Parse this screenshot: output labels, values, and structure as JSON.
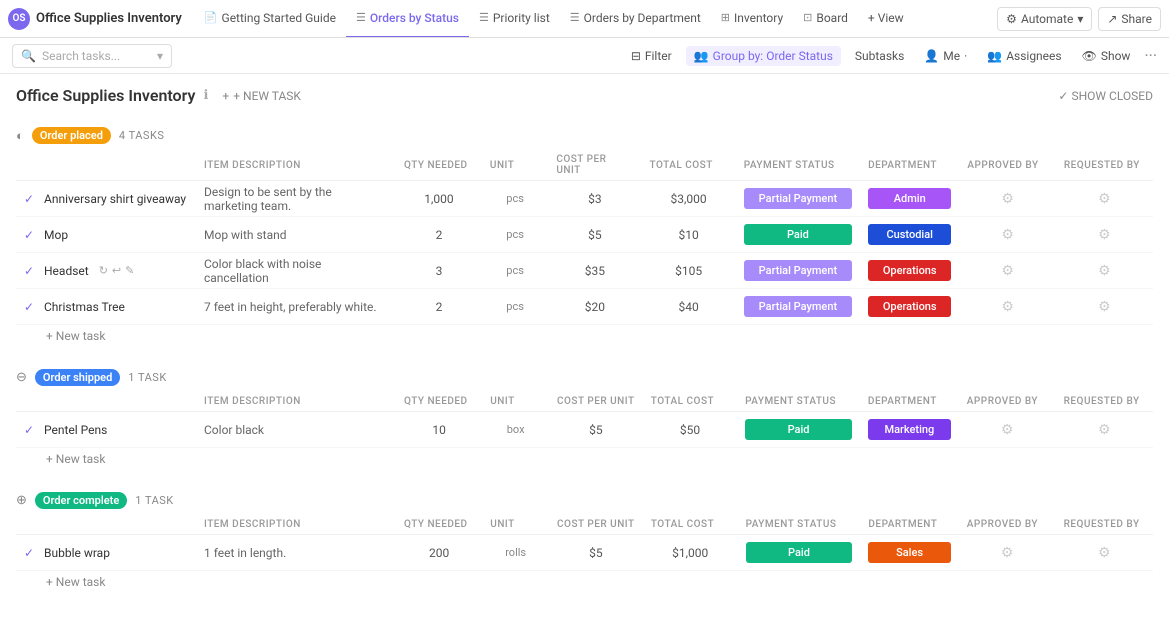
{
  "app": {
    "logo_text": "OS",
    "title": "Office Supplies Inventory"
  },
  "nav": {
    "tabs": [
      {
        "id": "getting-started",
        "label": "Getting Started Guide",
        "icon": "📄",
        "active": false
      },
      {
        "id": "orders-by-status",
        "label": "Orders by Status",
        "icon": "☰",
        "active": true
      },
      {
        "id": "priority-list",
        "label": "Priority list",
        "icon": "☰",
        "active": false
      },
      {
        "id": "orders-by-dept",
        "label": "Orders by Department",
        "icon": "☰",
        "active": false
      },
      {
        "id": "inventory",
        "label": "Inventory",
        "icon": "⊞",
        "active": false
      },
      {
        "id": "board",
        "label": "Board",
        "icon": "⊡",
        "active": false
      },
      {
        "id": "view",
        "label": "+ View",
        "icon": "",
        "active": false
      }
    ],
    "right_buttons": [
      {
        "id": "automate",
        "label": "Automate"
      },
      {
        "id": "share",
        "label": "Share"
      }
    ]
  },
  "toolbar": {
    "search_placeholder": "Search tasks...",
    "filter_label": "Filter",
    "group_by_label": "Group by: Order Status",
    "subtasks_label": "Subtasks",
    "me_label": "Me",
    "assignees_label": "Assignees",
    "show_label": "Show"
  },
  "page": {
    "title": "Office Supplies Inventory",
    "new_task_label": "+ NEW TASK",
    "show_closed_label": "✓ SHOW CLOSED"
  },
  "columns": {
    "task": "",
    "item_description": "ITEM DESCRIPTION",
    "qty_needed": "QTY NEEDED",
    "unit": "UNIT",
    "cost_per_unit": "COST PER UNIT",
    "total_cost": "TOTAL COST",
    "payment_status": "PAYMENT STATUS",
    "department": "DEPARTMENT",
    "approved_by": "APPROVED BY",
    "requested_by": "REQUESTED BY"
  },
  "groups": [
    {
      "id": "order-placed",
      "label": "Order placed",
      "badge_class": "badge-order-placed",
      "toggle": "◐",
      "count_label": "4 TASKS",
      "tasks": [
        {
          "name": "Anniversary shirt giveaway",
          "description": "Design to be sent by the marketing team.",
          "qty": "1,000",
          "unit": "pcs",
          "cost_per_unit": "$3",
          "total_cost": "$3,000",
          "payment_status": "Partial Payment",
          "payment_class": "payment-partial",
          "department": "Admin",
          "dept_class": "dept-admin",
          "has_icons": false
        },
        {
          "name": "Mop",
          "description": "Mop with stand",
          "qty": "2",
          "unit": "pcs",
          "cost_per_unit": "$5",
          "total_cost": "$10",
          "payment_status": "Paid",
          "payment_class": "payment-paid",
          "department": "Custodial",
          "dept_class": "dept-custodial",
          "has_icons": false
        },
        {
          "name": "Headset",
          "description": "Color black with noise cancellation",
          "qty": "3",
          "unit": "pcs",
          "cost_per_unit": "$35",
          "total_cost": "$105",
          "payment_status": "Partial Payment",
          "payment_class": "payment-partial",
          "department": "Operations",
          "dept_class": "dept-operations",
          "has_icons": true
        },
        {
          "name": "Christmas Tree",
          "description": "7 feet in height, preferably white.",
          "qty": "2",
          "unit": "pcs",
          "cost_per_unit": "$20",
          "total_cost": "$40",
          "payment_status": "Partial Payment",
          "payment_class": "payment-partial",
          "department": "Operations",
          "dept_class": "dept-operations",
          "has_icons": false
        }
      ]
    },
    {
      "id": "order-shipped",
      "label": "Order shipped",
      "badge_class": "badge-order-shipped",
      "toggle": "⊖",
      "count_label": "1 TASK",
      "tasks": [
        {
          "name": "Pentel Pens",
          "description": "Color black",
          "qty": "10",
          "unit": "box",
          "cost_per_unit": "$5",
          "total_cost": "$50",
          "payment_status": "Paid",
          "payment_class": "payment-paid",
          "department": "Marketing",
          "dept_class": "dept-marketing",
          "has_icons": false
        }
      ]
    },
    {
      "id": "order-complete",
      "label": "Order complete",
      "badge_class": "badge-order-complete",
      "toggle": "⊕",
      "count_label": "1 TASK",
      "tasks": [
        {
          "name": "Bubble wrap",
          "description": "1 feet in length.",
          "qty": "200",
          "unit": "rolls",
          "cost_per_unit": "$5",
          "total_cost": "$1,000",
          "payment_status": "Paid",
          "payment_class": "payment-paid",
          "department": "Sales",
          "dept_class": "dept-sales",
          "has_icons": false
        }
      ]
    }
  ]
}
